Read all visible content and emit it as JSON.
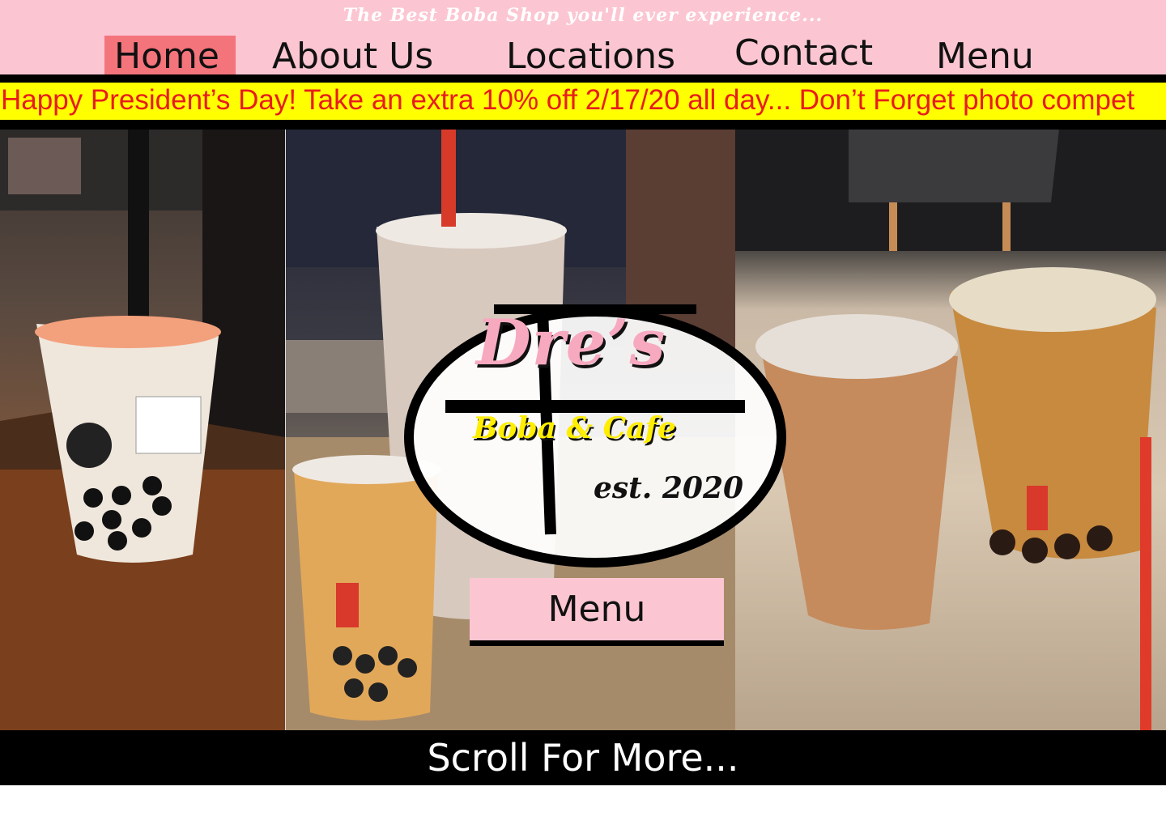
{
  "header": {
    "tagline": "The Best Boba Shop you'll ever experience...",
    "nav": [
      "Home",
      "About Us",
      "Locations",
      "Contact",
      "Menu"
    ],
    "active": "Home"
  },
  "promo": {
    "text": "Happy President’s Day! Take an extra 10% off 2/17/20 all day... Don’t Forget photo compet"
  },
  "logo": {
    "name": "Dre’s",
    "subtitle": "Boba & Cafe",
    "established": "est. 2020"
  },
  "hero": {
    "menu_button": "Menu"
  },
  "footer": {
    "scroll_text": "Scroll For More..."
  },
  "colors": {
    "header_bg": "#fbc6d2",
    "active_nav_bg": "#f4747c",
    "promo_bg": "#ffff00",
    "promo_text": "#e81c1c",
    "logo_pink": "#f7a9c0",
    "logo_yellow": "#ffee00"
  }
}
